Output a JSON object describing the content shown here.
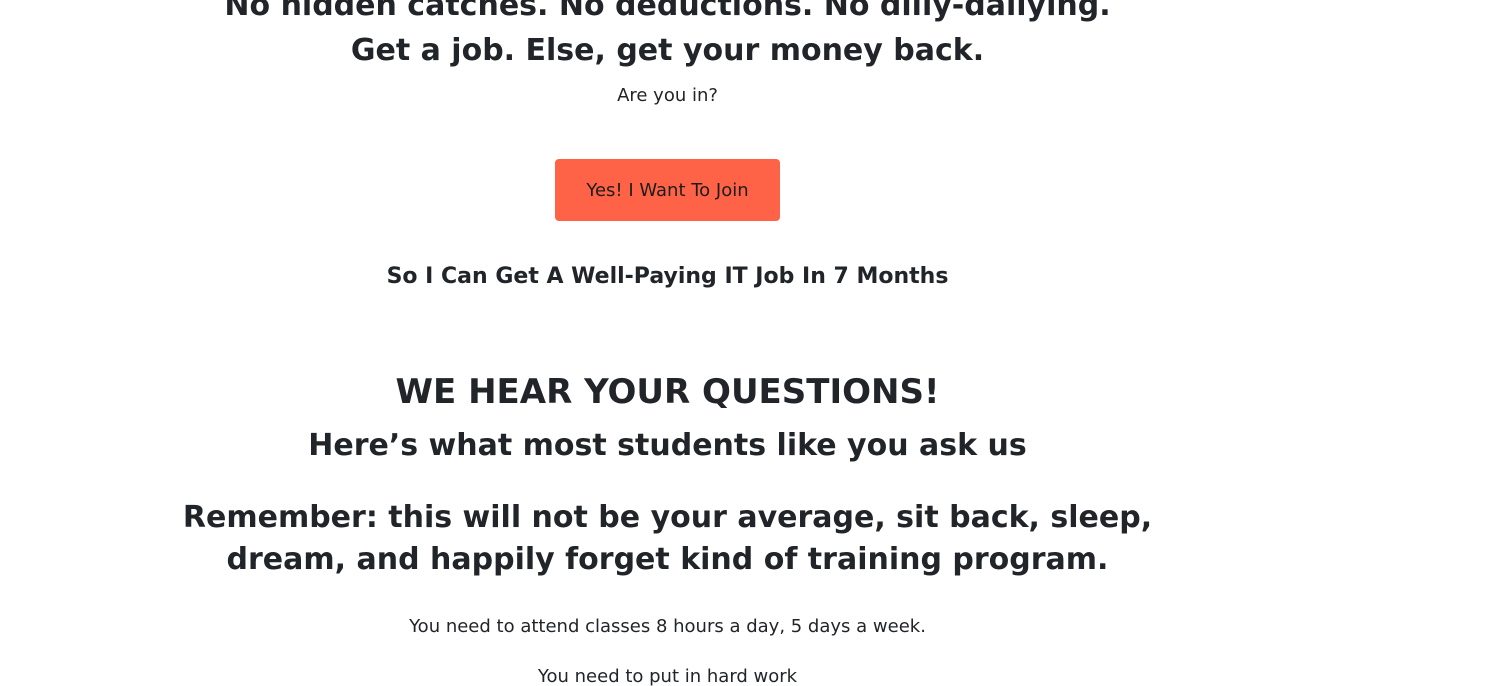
{
  "hero": {
    "line1": "No hidden catches. No deductions. No dilly-dallying.",
    "line2": "Get a job. Else, get your money back.",
    "question": "Are you in?"
  },
  "cta": {
    "button_label": "Yes! I Want To Join",
    "subtext": "So I Can Get A Well-Paying IT Job In 7 Months",
    "button_color": "#ff6347"
  },
  "questions": {
    "title": "WE HEAR YOUR QUESTIONS!",
    "subtitle": "Here’s what most students like you ask us",
    "remember": "Remember: this will not be your average, sit back, sleep, dream, and happily forget kind of training program.",
    "points": [
      "You need to attend classes 8 hours a day, 5 days a week.",
      "You need to put in hard work"
    ]
  }
}
